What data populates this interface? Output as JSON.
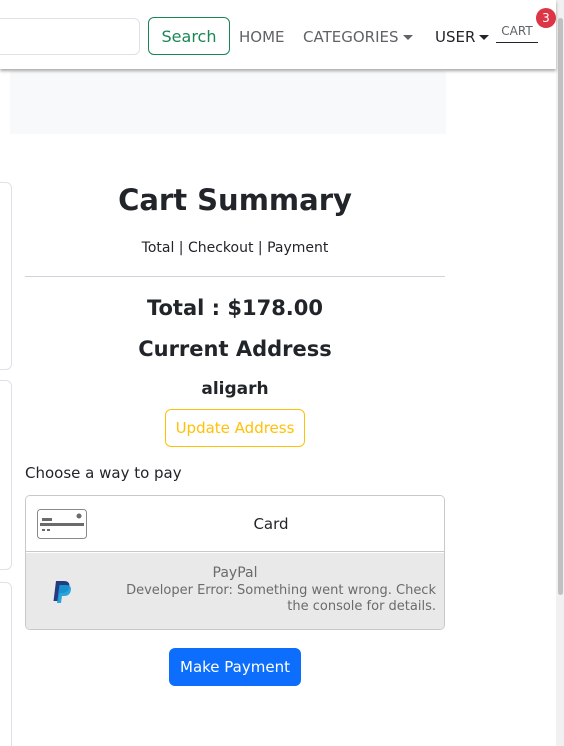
{
  "navbar": {
    "search_placeholder": "",
    "search_label": "Search",
    "home_label": "HOME",
    "categories_label": "CATEGORIES",
    "user_label": "USER",
    "cart_label": "CART",
    "cart_count": "3"
  },
  "cart": {
    "title": "Cart Summary",
    "steps": "Total | Checkout | Payment",
    "total": "Total : $178.00",
    "address_heading": "Current Address",
    "address_value": "aligarh",
    "update_address_label": "Update Address",
    "choose_pay_label": "Choose a way to pay"
  },
  "payment": {
    "card_label": "Card",
    "card_icon": "credit-card-icon",
    "paypal_label": "PayPal",
    "paypal_icon": "paypal-icon",
    "paypal_error": "Developer Error: Something went wrong. Check the console for details.",
    "make_payment_label": "Make Payment"
  },
  "colors": {
    "success": "#198754",
    "warning": "#ffc107",
    "primary": "#0d6efd",
    "danger": "#dc3545"
  }
}
